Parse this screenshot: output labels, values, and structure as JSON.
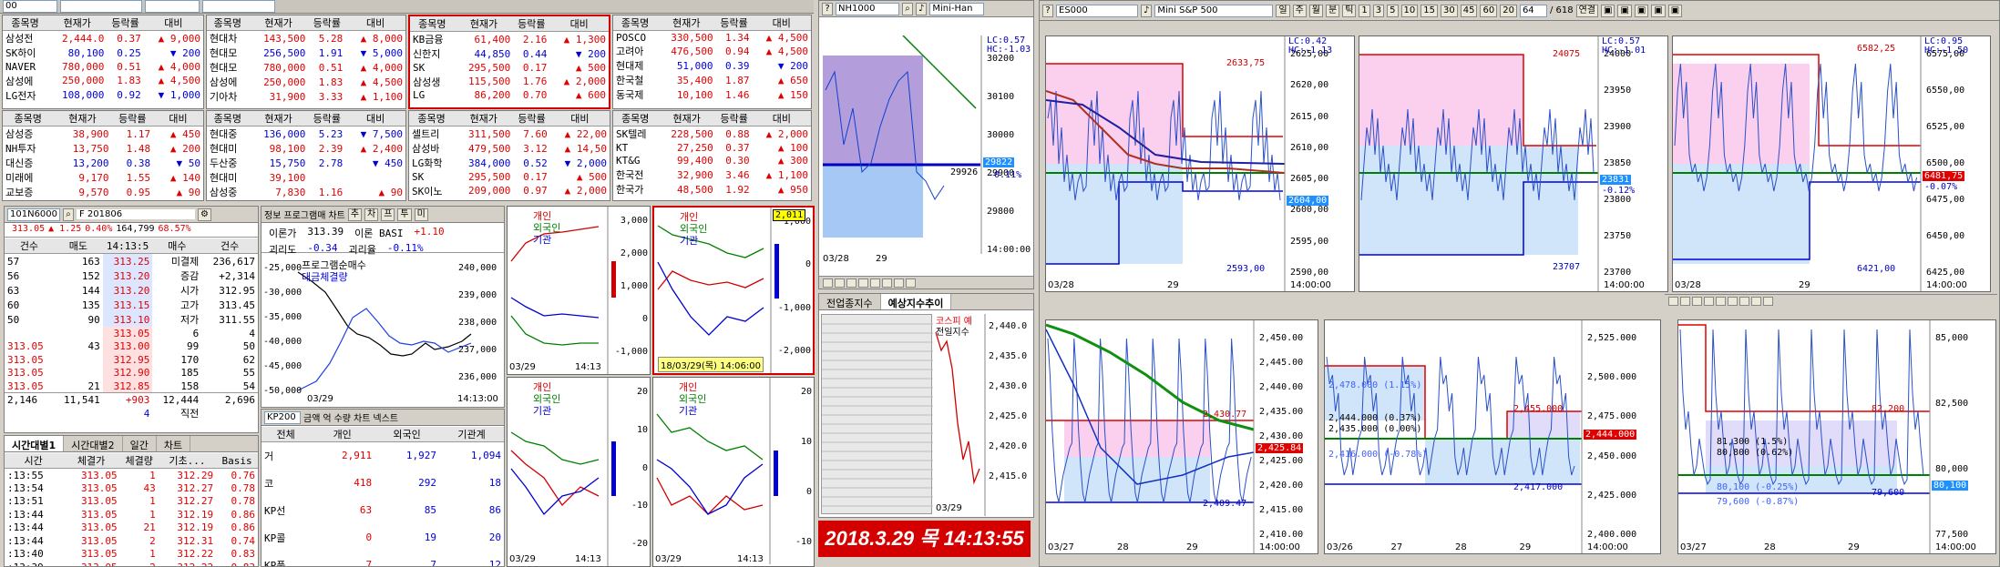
{
  "top_quotes": {
    "headers": [
      "종목명",
      "현재가",
      "등락률",
      "대비"
    ],
    "box1": [
      [
        "삼성전",
        "2,444.0",
        "0.37",
        "▲ 9,000"
      ],
      [
        "SK하이",
        "80,100",
        "0.25",
        "▼ 200"
      ],
      [
        "NAVER",
        "780,000",
        "0.51",
        "▲ 4,000"
      ],
      [
        "삼성에",
        "250,000",
        "1.83",
        "▲ 4,500"
      ],
      [
        "LG전자",
        "108,000",
        "0.92",
        "▼ 1,000"
      ]
    ],
    "box2": [
      [
        "현대차",
        "143,500",
        "5.28",
        "▲ 8,000"
      ],
      [
        "현대모",
        "256,500",
        "1.91",
        "▼ 5,000"
      ],
      [
        "현대모",
        "780,000",
        "0.51",
        "▲ 4,000"
      ],
      [
        "삼성에",
        "250,000",
        "1.83",
        "▲ 4,500"
      ],
      [
        "기아차",
        "31,900",
        "3.33",
        "▲ 1,100"
      ]
    ],
    "box3": [
      [
        "KB금융",
        "61,400",
        "2.16",
        "▲ 1,300"
      ],
      [
        "신한지",
        "44,850",
        "0.44",
        "▼ 200"
      ],
      [
        "SK",
        "295,500",
        "0.17",
        "▲ 500"
      ],
      [
        "삼성생",
        "115,500",
        "1.76",
        "▲ 2,000"
      ],
      [
        "LG",
        "86,200",
        "0.70",
        "▲ 600"
      ]
    ],
    "box4": [
      [
        "POSCO",
        "330,500",
        "1.34",
        "▲ 4,500"
      ],
      [
        "고려아",
        "476,500",
        "0.94",
        "▲ 4,500"
      ],
      [
        "현대제",
        "51,000",
        "0.39",
        "▼ 200"
      ],
      [
        "한국철",
        "35,400",
        "1.87",
        "▲ 650"
      ],
      [
        "동국제",
        "10,100",
        "1.46",
        "▲ 150"
      ]
    ],
    "box5": [
      [
        "삼성증",
        "38,900",
        "1.17",
        "▲ 450"
      ],
      [
        "NH투자",
        "13,750",
        "1.48",
        "▲ 200"
      ],
      [
        "대신증",
        "13,200",
        "0.38",
        "▼ 50"
      ],
      [
        "미래에",
        "9,170",
        "1.55",
        "▲ 140"
      ],
      [
        "교보증",
        "9,570",
        "0.95",
        "▲ 90"
      ]
    ],
    "box6": [
      [
        "현대중",
        "136,000",
        "5.23",
        "▼ 7,500"
      ],
      [
        "현대미",
        "98,100",
        "2.39",
        "▲ 2,400"
      ],
      [
        "두산중",
        "15,750",
        "2.78",
        "▼ 450"
      ],
      [
        "현대미",
        "39,100",
        "",
        ""
      ],
      [
        "삼성중",
        "7,830",
        "1.16",
        "▲ 90"
      ]
    ],
    "box7": [
      [
        "셀트리",
        "311,500",
        "7.60",
        "▲ 22,00"
      ],
      [
        "삼성바",
        "479,500",
        "3.12",
        "▲ 14,50"
      ],
      [
        "LG화학",
        "384,000",
        "0.52",
        "▼ 2,000"
      ],
      [
        "SK",
        "295,500",
        "0.17",
        "▲ 500"
      ],
      [
        "SK이노",
        "209,000",
        "0.97",
        "▲ 2,000"
      ]
    ],
    "box8": [
      [
        "SK텔레",
        "228,500",
        "0.88",
        "▲ 2,000"
      ],
      [
        "KT",
        "27,250",
        "0.37",
        "▲ 100"
      ],
      [
        "KT&G",
        "99,400",
        "0.30",
        "▲ 300"
      ],
      [
        "한국전",
        "32,900",
        "3.46",
        "▲ 1,100"
      ],
      [
        "한국가",
        "48,500",
        "1.92",
        "▲ 950"
      ]
    ]
  },
  "futures_panel": {
    "code": "101N6000",
    "name": "F 201806",
    "price": "313.05",
    "change": "▲ 1.25",
    "rate": "0.40%",
    "volume": "164,799",
    "extra": "68.57%",
    "headers": [
      "건수",
      "매도",
      "14:13:5",
      "매수",
      "건수"
    ],
    "rows": [
      [
        "57",
        "163",
        "313.25",
        "미결제",
        "236,617"
      ],
      [
        "56",
        "152",
        "313.20",
        "증감",
        "+2,314"
      ],
      [
        "63",
        "144",
        "313.20",
        "시가",
        "312.95"
      ],
      [
        "60",
        "135",
        "313.15",
        "고가",
        "313.45"
      ],
      [
        "50",
        "90",
        "313.10",
        "저가",
        "311.55"
      ],
      [
        "",
        "",
        "313.05",
        "6",
        "4"
      ],
      [
        "313.05",
        "43",
        "313.00",
        "99",
        "50"
      ],
      [
        "313.05",
        "",
        "312.95",
        "170",
        "62"
      ],
      [
        "313.05",
        "",
        "312.90",
        "185",
        "55"
      ],
      [
        "313.05",
        "21",
        "312.85",
        "158",
        "54"
      ]
    ],
    "totals": [
      "2,146",
      "11,541",
      "+903",
      "12,444",
      "2,696"
    ],
    "footer": [
      "4",
      "직전"
    ]
  },
  "ticks": {
    "tabs": [
      "시간대별1",
      "시간대별2",
      "일간",
      "차트"
    ],
    "headers": [
      "시간",
      "체결가",
      "체결량",
      "기초...",
      "Basis"
    ],
    "rows": [
      [
        ":13:55",
        "313.05",
        "1",
        "312.29",
        "0.76"
      ],
      [
        ":13:54",
        "313.05",
        "43",
        "312.27",
        "0.78"
      ],
      [
        ":13:51",
        "313.05",
        "1",
        "312.27",
        "0.78"
      ],
      [
        ":13:44",
        "313.05",
        "1",
        "312.19",
        "0.86"
      ],
      [
        ":13:44",
        "313.05",
        "21",
        "312.19",
        "0.86"
      ],
      [
        ":13:44",
        "313.05",
        "2",
        "312.31",
        "0.74"
      ],
      [
        ":13:40",
        "313.05",
        "1",
        "312.22",
        "0.83"
      ],
      [
        ":13:39",
        "313.05",
        "2",
        "312.22",
        "0.83"
      ]
    ]
  },
  "program": {
    "options": [
      "정보",
      "프로그램매",
      "차트",
      "추",
      "차",
      "프",
      "투",
      "미"
    ],
    "label1": "이론가",
    "val1": "313.39",
    "label2": "이론 BASI",
    "val2": "+1.10",
    "label3": "괴리도",
    "val3": "-0.34",
    "label4": "괴리율",
    "val4": "-0.11%",
    "legend1": "프로그램순매수",
    "legend2": "대금체결량",
    "yleft": [
      "-25,000",
      "-30,000",
      "-35,000",
      "-40,000",
      "-45,000",
      "-50,000"
    ],
    "yright": [
      "240,000",
      "239,000",
      "238,000",
      "237,000",
      "236,000"
    ],
    "date": "03/29",
    "time": "14:13:00"
  },
  "investor": {
    "tab": "KP200",
    "radios": [
      "금액",
      "억",
      "수량",
      "차트",
      "넥스트"
    ],
    "headers": [
      "전체",
      "개인",
      "외국인",
      "기관계"
    ],
    "rows": [
      [
        "거",
        "2,911",
        "1,927",
        "1,094"
      ],
      [
        "코",
        "418",
        "292",
        "18"
      ],
      [
        "KP선",
        "63",
        "85",
        "86"
      ],
      [
        "KP콜",
        "0",
        "19",
        "20"
      ],
      [
        "KP풋",
        "7",
        "7",
        "12"
      ]
    ]
  },
  "mini_charts": {
    "legend": [
      "개인",
      "외국인",
      "기관"
    ],
    "c1": {
      "y": [
        "3,000",
        "2,000",
        "1,000",
        "0",
        "-1,000"
      ],
      "date": "03/29",
      "time": "14:13"
    },
    "c2": {
      "y": [
        "1,000",
        "0",
        "-1,000",
        "-2,000"
      ],
      "tag": "2,011",
      "footer": "18/03/29(목) 14:06:00"
    },
    "c3": {
      "y": [
        "20",
        "10",
        "0",
        "-10",
        "-20"
      ],
      "date": "03/29",
      "time": "14:13"
    },
    "c4": {
      "y": [
        "20",
        "10",
        "0",
        "-10"
      ],
      "date": "03/29",
      "time": "14:13"
    }
  },
  "nikkei": {
    "code": "NH1000",
    "name": "Mini-Han",
    "lc": "LC:0.57",
    "hc": "HC:-1.03",
    "y": [
      "30200",
      "30100",
      "30000",
      "29900",
      "29800",
      "14:00:00"
    ],
    "tag": "29926",
    "tag2": "29822",
    "pct": "-0.11%",
    "x": [
      "03/28",
      "29"
    ]
  },
  "kospi_exp": {
    "tabs": [
      "전업종지수",
      "예상지수추이"
    ],
    "legend1": "코스피 예",
    "legend2": "전일지수",
    "y": [
      "2,440.0",
      "2,435.0",
      "2,430.0",
      "2,425.0",
      "2,420.0",
      "2,415.0"
    ],
    "date": "03/29"
  },
  "datetime": "2018.3.29 목 14:13:55",
  "es": {
    "code": "ES000",
    "name": "Mini S&P 500",
    "period": [
      "일",
      "주",
      "월",
      "분",
      "틱"
    ],
    "nums": [
      "1",
      "3",
      "5",
      "10",
      "15",
      "30",
      "45",
      "60",
      "20"
    ],
    "count": "64",
    "total": "/ 618",
    "btn": "연결",
    "c1": {
      "y": [
        "2625,00",
        "2620,00",
        "2615,00",
        "2610,00",
        "2605,00",
        "2600,00",
        "2595,00",
        "2590,00"
      ],
      "top": "2633,75",
      "bot": "2593,00",
      "cur": "2604,00",
      "lc": "LC:0.42",
      "hc": "HC:-1.13",
      "x": [
        "03/28",
        "29"
      ],
      "time": "14:00:00"
    },
    "c2": {
      "y": [
        "24000",
        "23950",
        "23900",
        "23850",
        "23800",
        "23750",
        "23700"
      ],
      "top": "24075",
      "bot": "23707",
      "cur": "23831",
      "pct": "-0.12%",
      "lc": "LC:0.57",
      "hc": "HC:-1.01",
      "time": "14:00:00"
    },
    "c3": {
      "y": [
        "6575,00",
        "6550,00",
        "6525,00",
        "6500,00",
        "6475,00",
        "6450,00",
        "6425,00"
      ],
      "top": "6582,25",
      "bot": "6421,00",
      "cur": "6481,75",
      "pct": "-0.07%",
      "lc": "LC:0.95",
      "hc": "HC:-1.50",
      "x": [
        "03/28",
        "29"
      ],
      "time": "14:00:00"
    },
    "c4": {
      "y": [
        "2,450.00",
        "2,445.00",
        "2,440.00",
        "2,435.00",
        "2,430.00",
        "2,425.00",
        "2,420.00",
        "2,415.00",
        "2,410.00"
      ],
      "top": "2,430.77",
      "bot": "2,409.47",
      "cur": "2,425.84",
      "x": [
        "03/27",
        "28",
        "29"
      ],
      "time": "14:00:00"
    },
    "c5": {
      "y": [
        "2,525.000",
        "2,500.000",
        "2,475.000",
        "2,450.000",
        "2,425.000",
        "2,400.000"
      ],
      "top": "2,455.000",
      "bot": "2,417.000",
      "cur": "2,444.000",
      "l1": "2,444.000 (0.37%)",
      "l2": "2,435.000 (0.00%)",
      "l3": "2,416.000 (-0.78%)",
      "l4": "2,478.000 (1.15%)",
      "x": [
        "03/26",
        "27",
        "28",
        "29"
      ],
      "time": "14:00:00"
    },
    "c6": {
      "y": [
        "85,000",
        "82,500",
        "80,000",
        "77,500"
      ],
      "top": "82,200",
      "bot": "79,600",
      "cur": "80,100",
      "l1": "81,300 (1.5%)",
      "l2": "80,800 (0.62%)",
      "l3": "80,100 (-0.25%)",
      "l4": "79,600 (-0.87%)",
      "x": [
        "03/27",
        "28",
        "29"
      ],
      "time": "14:00:00"
    }
  }
}
